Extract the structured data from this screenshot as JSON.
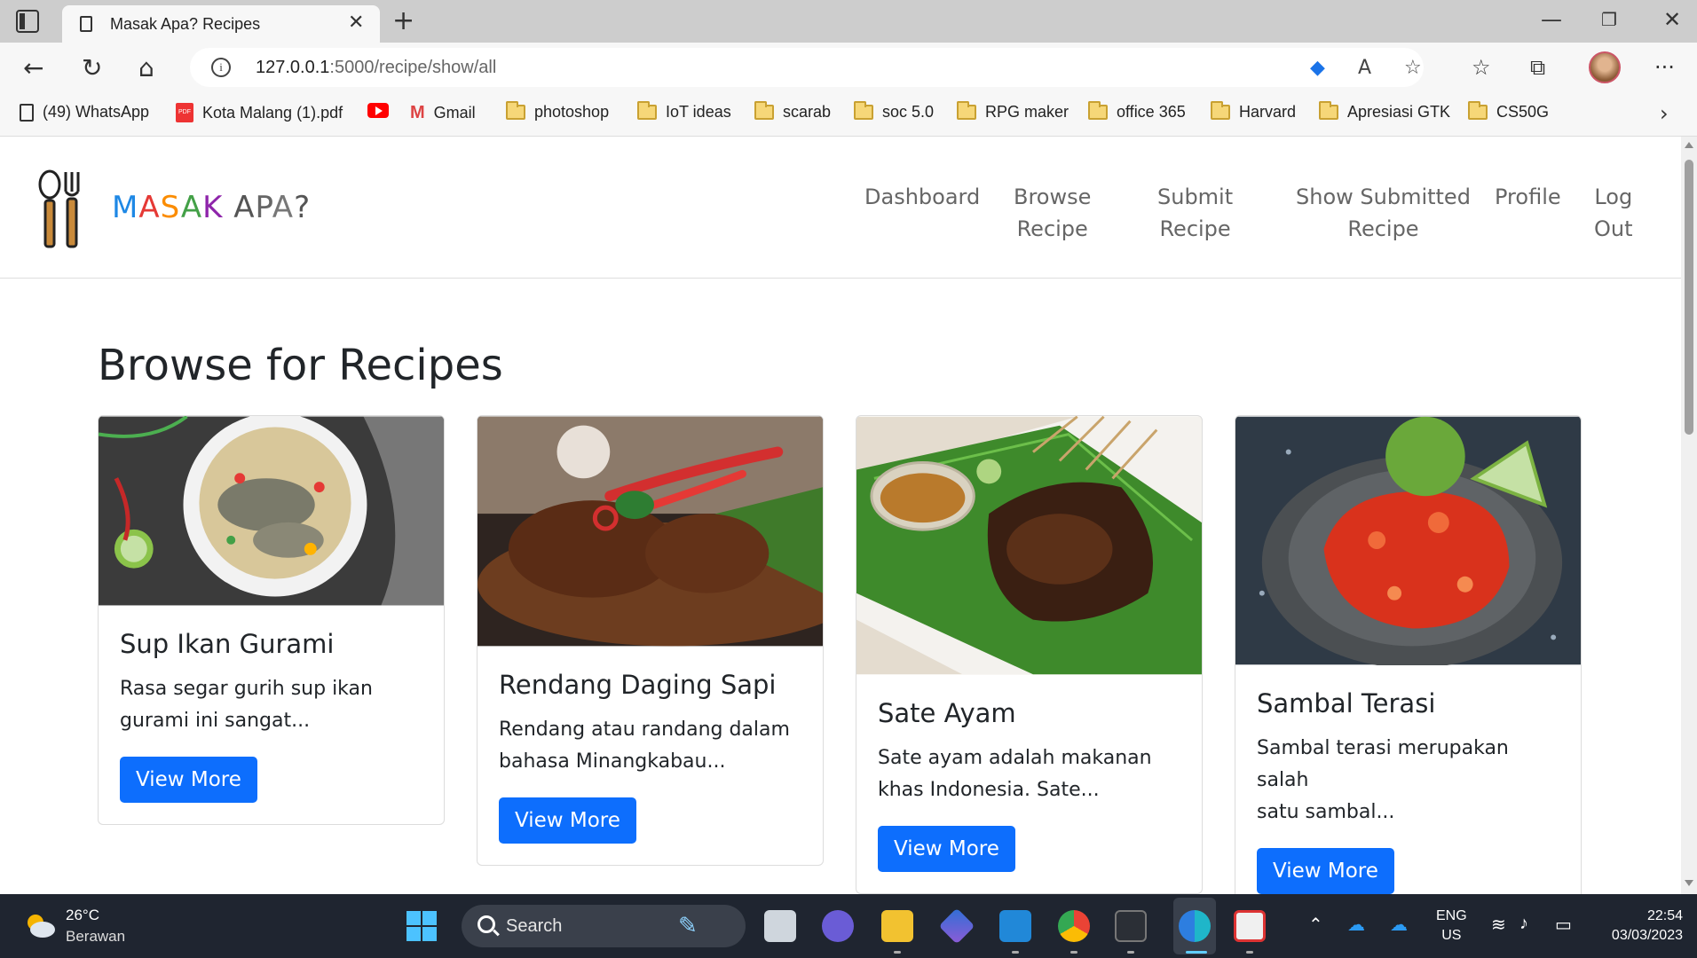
{
  "browser": {
    "tab_title": "Masak Apa? Recipes",
    "url_host": "127.0.0.1",
    "url_rest": ":5000/recipe/show/all",
    "bookmarks": [
      {
        "label": "(49) WhatsApp",
        "icon": "page-icon"
      },
      {
        "label": "Kota Malang (1).pdf",
        "icon": "pdf-icon"
      },
      {
        "label": "",
        "icon": "youtube-icon"
      },
      {
        "label": "Gmail",
        "icon": "gmail-icon"
      },
      {
        "label": "photoshop",
        "icon": "folder-icon"
      },
      {
        "label": "IoT ideas",
        "icon": "folder-icon"
      },
      {
        "label": "scarab",
        "icon": "folder-icon"
      },
      {
        "label": "soc 5.0",
        "icon": "folder-icon"
      },
      {
        "label": "RPG maker",
        "icon": "folder-icon"
      },
      {
        "label": "office 365",
        "icon": "folder-icon"
      },
      {
        "label": "Harvard",
        "icon": "folder-icon"
      },
      {
        "label": "Apresiasi GTK",
        "icon": "folder-icon"
      },
      {
        "label": "CS50G",
        "icon": "folder-icon"
      }
    ]
  },
  "site": {
    "brand": "MASAK APA?",
    "nav": [
      {
        "line1": "Dashboard",
        "line2": ""
      },
      {
        "line1": "Browse",
        "line2": "Recipe"
      },
      {
        "line1": "Submit",
        "line2": "Recipe"
      },
      {
        "line1": "Show Submitted",
        "line2": "Recipe"
      },
      {
        "line1": "Profile",
        "line2": ""
      },
      {
        "line1": "Log",
        "line2": "Out"
      }
    ],
    "heading": "Browse for Recipes",
    "button_label": "View More",
    "recipes": [
      {
        "title": "Sup Ikan Gurami",
        "line1": "Rasa segar gurih sup ikan",
        "line2": "gurami ini sangat..."
      },
      {
        "title": "Rendang Daging Sapi",
        "line1": "Rendang atau randang dalam",
        "line2": "bahasa Minangkabau..."
      },
      {
        "title": "Sate Ayam",
        "line1": "Sate ayam adalah makanan",
        "line2": "khas Indonesia. Sate..."
      },
      {
        "title": "Sambal Terasi",
        "line1": "Sambal terasi merupakan salah",
        "line2": "satu sambal..."
      }
    ]
  },
  "taskbar": {
    "temperature": "26°C",
    "weather": "Berawan",
    "search_label": "Search",
    "lang_top": "ENG",
    "lang_bottom": "US",
    "time": "22:54",
    "date": "03/03/2023"
  },
  "colors": {
    "primary_button": "#0d6efd",
    "taskbar_bg": "#1f2530"
  }
}
